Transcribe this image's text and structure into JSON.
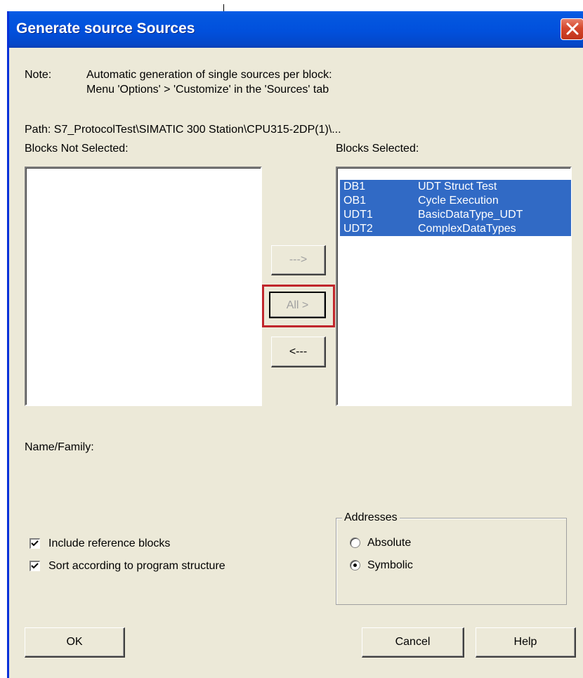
{
  "dialog": {
    "title": "Generate source Sources",
    "note_label": "Note:",
    "note_line1": "Automatic generation of single sources per block:",
    "note_line2": "Menu 'Options' > 'Customize' in the 'Sources' tab",
    "path_text": "Path:  S7_ProtocolTest\\SIMATIC 300 Station\\CPU315-2DP(1)\\...",
    "not_selected_label": "Blocks Not Selected:",
    "selected_label": "Blocks Selected:",
    "selected_blocks": [
      {
        "name": "DB1",
        "description": "UDT Struct Test"
      },
      {
        "name": "OB1",
        "description": "Cycle Execution"
      },
      {
        "name": "UDT1",
        "description": "BasicDataType_UDT"
      },
      {
        "name": "UDT2",
        "description": "ComplexDataTypes"
      }
    ],
    "buttons": {
      "add": "--->",
      "add_all": "All >",
      "remove": "<---",
      "ok": "OK",
      "cancel": "Cancel",
      "help": "Help"
    },
    "name_family_label": "Name/Family:",
    "checkboxes": [
      {
        "label": "Include reference blocks",
        "checked": true
      },
      {
        "label": "Sort according to program structure",
        "checked": true
      }
    ],
    "addresses": {
      "legend": "Addresses",
      "options": [
        {
          "label": "Absolute",
          "selected": false
        },
        {
          "label": "Symbolic",
          "selected": true
        }
      ]
    }
  },
  "colors": {
    "titlebar": "#0150dc",
    "selection": "#316ac5",
    "highlight_box": "#c0262c",
    "dialog_bg": "#ece9d8"
  }
}
